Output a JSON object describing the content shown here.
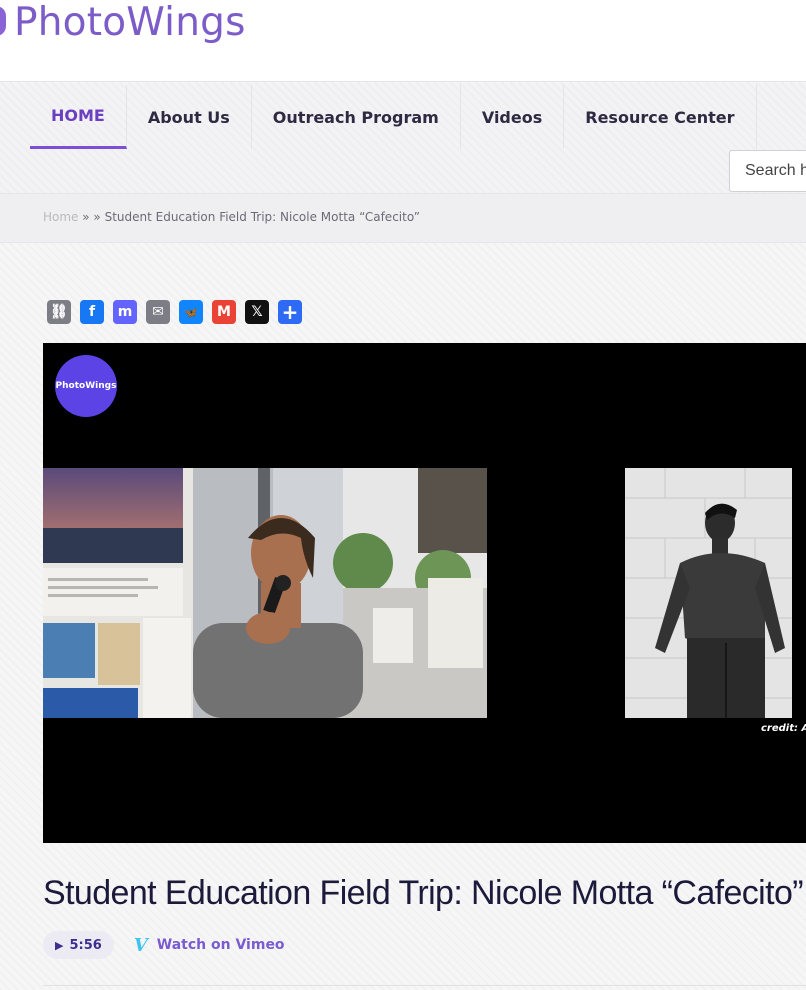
{
  "site": {
    "name": "PhotoWings"
  },
  "nav": {
    "items": [
      {
        "label": "HOME",
        "active": true
      },
      {
        "label": "About Us"
      },
      {
        "label": "Outreach Program"
      },
      {
        "label": "Videos"
      },
      {
        "label": "Resource Center"
      }
    ]
  },
  "search": {
    "placeholder": "Search here"
  },
  "breadcrumb": {
    "home": "Home",
    "separator": " » » ",
    "current": "Student Education Field Trip: Nicole Motta “Cafecito”"
  },
  "share": {
    "icons": [
      {
        "name": "copy-link-icon",
        "glyph": "⛓",
        "color": "#7d7d86"
      },
      {
        "name": "facebook-icon",
        "glyph": "f",
        "color": "#1877f2"
      },
      {
        "name": "mastodon-icon",
        "glyph": "m",
        "color": "#6364ff"
      },
      {
        "name": "email-icon",
        "glyph": "✉",
        "color": "#7d7d86"
      },
      {
        "name": "bluesky-icon",
        "glyph": "🦋",
        "color": "#1185fe"
      },
      {
        "name": "gmail-icon",
        "glyph": "M",
        "color": "#ea4335"
      },
      {
        "name": "x-icon",
        "glyph": "𝕏",
        "color": "#111111"
      },
      {
        "name": "add-share-icon",
        "glyph": "+",
        "color": "#2f6af5"
      }
    ]
  },
  "video": {
    "badge": "PhotoWings",
    "credit": "credit: A"
  },
  "post": {
    "title": "Student Education Field Trip: Nicole Motta “Cafecito”",
    "duration": "5:56",
    "watch_label": "Watch on Vimeo"
  }
}
